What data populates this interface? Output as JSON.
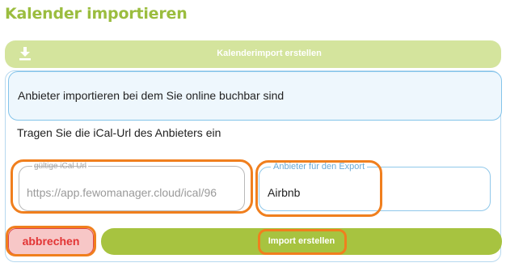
{
  "page": {
    "title": "Kalender importieren"
  },
  "create_bar": {
    "label": "Kalenderimport erstellen",
    "icon": "download-icon"
  },
  "provider_box": {
    "text": "Anbieter importieren bei dem Sie online buchbar sind"
  },
  "hint": {
    "text": "Tragen Sie die iCal-Url des Anbieters ein"
  },
  "ical_field": {
    "label": "gültige iCal Url",
    "value": "https://app.fewomanager.cloud/ical/96"
  },
  "export_field": {
    "label": "Anbieter für den Export",
    "value": "Airbnb"
  },
  "buttons": {
    "cancel": "abbrechen",
    "import": "Import erstellen"
  },
  "colors": {
    "accent": "#a7c340",
    "title": "#9bbd3f",
    "highlight": "#f07f1e",
    "danger": "#e23434",
    "info_border": "#84c4ea"
  }
}
